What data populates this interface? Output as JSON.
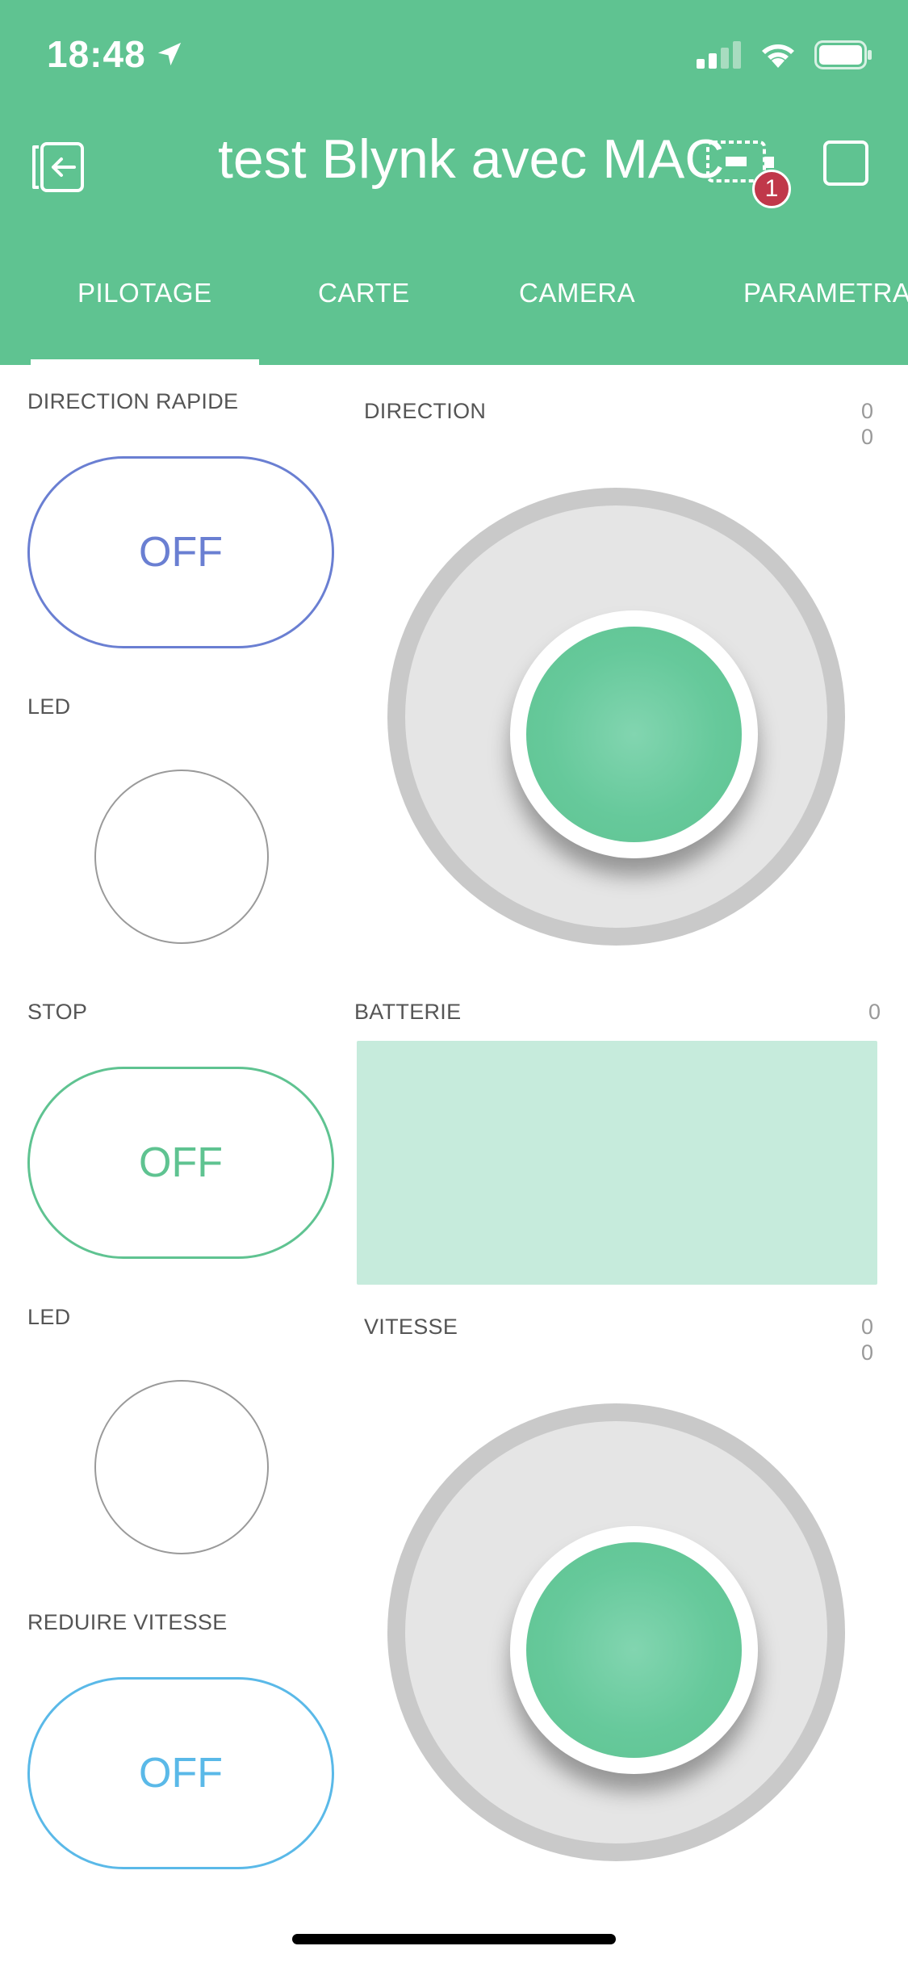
{
  "status_bar": {
    "time": "18:48"
  },
  "header": {
    "title": "test Blynk avec MAC",
    "device_badge_count": "1",
    "tabs": [
      {
        "label": "PILOTAGE",
        "active": true
      },
      {
        "label": "CARTE",
        "active": false
      },
      {
        "label": "CAMERA",
        "active": false
      },
      {
        "label": "PARAMETRAG",
        "active": false
      }
    ]
  },
  "widgets": {
    "direction_rapide": {
      "label": "DIRECTION RAPIDE",
      "state": "OFF",
      "color": "#6a7fd2"
    },
    "led_1": {
      "label": "LED"
    },
    "direction": {
      "label": "DIRECTION",
      "x_value": "0",
      "y_value": "0"
    },
    "stop": {
      "label": "STOP",
      "state": "OFF",
      "color": "#5fc391"
    },
    "batterie": {
      "label": "BATTERIE",
      "value": "0"
    },
    "led_2": {
      "label": "LED"
    },
    "vitesse": {
      "label": "VITESSE",
      "x_value": "0",
      "y_value": "0"
    },
    "reduire_vitesse": {
      "label": "REDUIRE VITESSE",
      "state": "OFF",
      "color": "#5ab9e8"
    }
  },
  "colors": {
    "header_bg": "#5fc391",
    "joystick_knob": "#66c99b",
    "battery_fill": "#c6ebdc",
    "badge": "#c0384a"
  }
}
